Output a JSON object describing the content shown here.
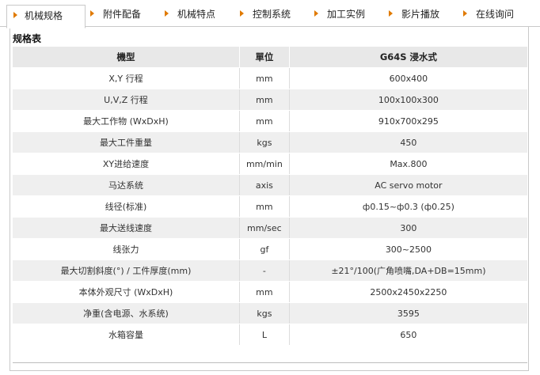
{
  "tabs": [
    {
      "label": "机械规格",
      "active": true
    },
    {
      "label": "附件配备",
      "active": false
    },
    {
      "label": "机械特点",
      "active": false
    },
    {
      "label": "控制系统",
      "active": false
    },
    {
      "label": "加工实例",
      "active": false
    },
    {
      "label": "影片播放",
      "active": false
    },
    {
      "label": "在线询问",
      "active": false
    }
  ],
  "panel": {
    "title": "规格表",
    "table": {
      "headers": [
        "機型",
        "單位",
        "G64S 浸水式"
      ],
      "rows": [
        [
          "X,Y 行程",
          "mm",
          "600x400"
        ],
        [
          "U,V,Z 行程",
          "mm",
          "100x100x300"
        ],
        [
          "最大工作物 (WxDxH)",
          "mm",
          "910x700x295"
        ],
        [
          "最大工件重量",
          "kgs",
          "450"
        ],
        [
          "XY进给速度",
          "mm/min",
          "Max.800"
        ],
        [
          "马达系统",
          "axis",
          "AC servo motor"
        ],
        [
          "线径(标准)",
          "mm",
          "ф0.15~ф0.3 (ф0.25)"
        ],
        [
          "最大送线速度",
          "mm/sec",
          "300"
        ],
        [
          "线张力",
          "gf",
          "300~2500"
        ],
        [
          "最大切割斜度(°) / 工件厚度(mm)",
          "-",
          "±21°/100(广角喷嘴,DA+DB=15mm)"
        ],
        [
          "本体外观尺寸 (WxDxH)",
          "mm",
          "2500x2450x2250"
        ],
        [
          "净重(含电源、水系统)",
          "kgs",
          "3595"
        ],
        [
          "水箱容量",
          "L",
          "650"
        ]
      ]
    }
  },
  "colors": {
    "tab_arrow": "#e07a00",
    "header_bg": "#e8e8e8",
    "row_alt_bg": "#efefef",
    "border": "#c9c9c9"
  }
}
